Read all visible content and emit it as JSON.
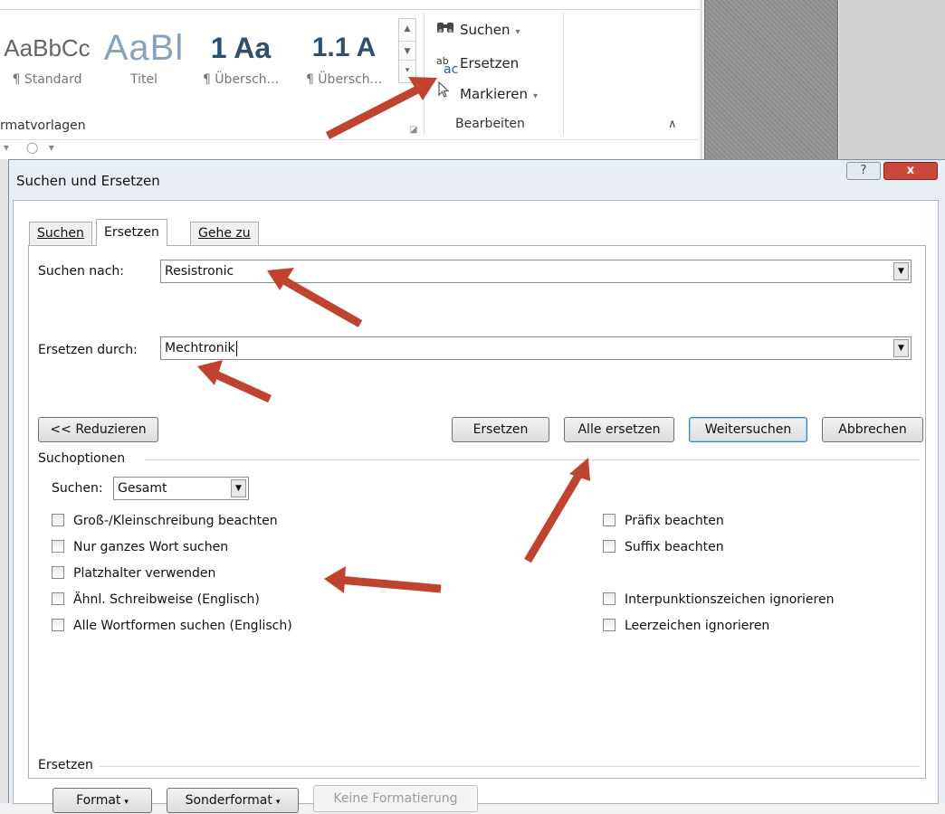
{
  "ribbon": {
    "style_gallery": [
      {
        "preview": "AaBbCc",
        "name": "¶ Standard"
      },
      {
        "preview": "AaBl",
        "name": "Titel"
      },
      {
        "preview": "1 Aa",
        "name": "¶ Übersch..."
      },
      {
        "preview": "1.1 A",
        "name": "¶ Übersch..."
      }
    ],
    "styles_group_label": "rmatvorlagen",
    "edit_group": {
      "suchen": "Suchen",
      "ersetzen": "Ersetzen",
      "markieren": "Markieren",
      "label": "Bearbeiten"
    },
    "ersetzen_icon_top": "ab",
    "ersetzen_icon_bottom": "ac"
  },
  "dialog": {
    "title": "Suchen und Ersetzen",
    "help": "?",
    "close": "x",
    "tabs": [
      "Suchen",
      "Ersetzen",
      "Gehe zu"
    ],
    "active_tab": "Ersetzen",
    "find_label": "Suchen nach:",
    "find_value": "Resistronic",
    "replace_label": "Ersetzen durch:",
    "replace_value": "Mechtronik",
    "buttons": {
      "reduzieren": "<< Reduzieren",
      "ersetzen": "Ersetzen",
      "alle_ersetzen": "Alle ersetzen",
      "weitersuchen": "Weitersuchen",
      "abbrechen": "Abbrechen"
    },
    "options_heading": "Suchoptionen",
    "scope_label": "Suchen:",
    "scope_value": "Gesamt",
    "options_left": [
      "Groß-/Kleinschreibung beachten",
      "Nur ganzes Wort suchen",
      "Platzhalter verwenden",
      "Ähnl. Schreibweise (Englisch)",
      "Alle Wortformen suchen (Englisch)"
    ],
    "options_right": [
      "Präfix beachten",
      "Suffix beachten",
      "Interpunktionszeichen ignorieren",
      "Leerzeichen ignorieren"
    ],
    "replace_heading": "Ersetzen",
    "format_buttons": {
      "format": "Format",
      "sonderformat": "Sonderformat",
      "keine_formatierung": "Keine Formatierung"
    }
  },
  "colors": {
    "annotation_arrow": "#c0432f",
    "close_button": "#c9483a",
    "default_button_border": "#3c7fb1"
  }
}
